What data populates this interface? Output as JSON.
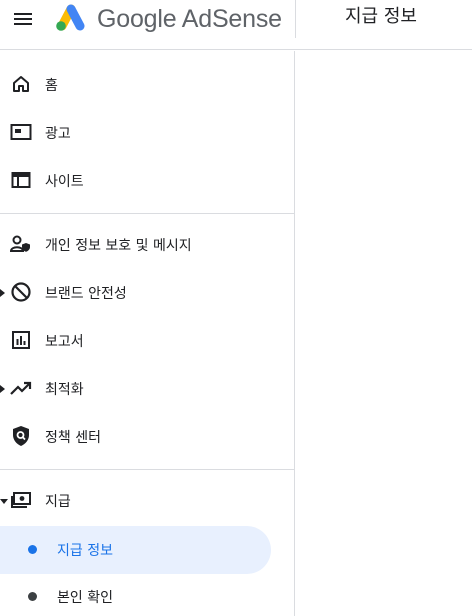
{
  "header": {
    "brand_text": "Google AdSense",
    "page_title": "지급 정보",
    "logo_colors": [
      "#fbbc04",
      "#4285f4",
      "#34a853"
    ]
  },
  "sidebar": {
    "items": [
      {
        "label": "홈",
        "icon": "home-icon"
      },
      {
        "label": "광고",
        "icon": "ads-icon"
      },
      {
        "label": "사이트",
        "icon": "sites-icon"
      },
      {
        "label": "개인 정보 보호 및 메시지",
        "icon": "privacy-messaging-icon"
      },
      {
        "label": "브랜드 안전성",
        "icon": "brand-safety-icon"
      },
      {
        "label": "보고서",
        "icon": "reports-icon"
      },
      {
        "label": "최적화",
        "icon": "optimization-icon"
      },
      {
        "label": "정책 센터",
        "icon": "policy-center-icon"
      },
      {
        "label": "지급",
        "icon": "payments-icon"
      }
    ],
    "payments_sub": [
      {
        "label": "지급 정보",
        "active": true
      },
      {
        "label": "본인 확인",
        "active": false
      }
    ],
    "accent_color": "#1a73e8",
    "active_bg": "#e8f0fe"
  }
}
